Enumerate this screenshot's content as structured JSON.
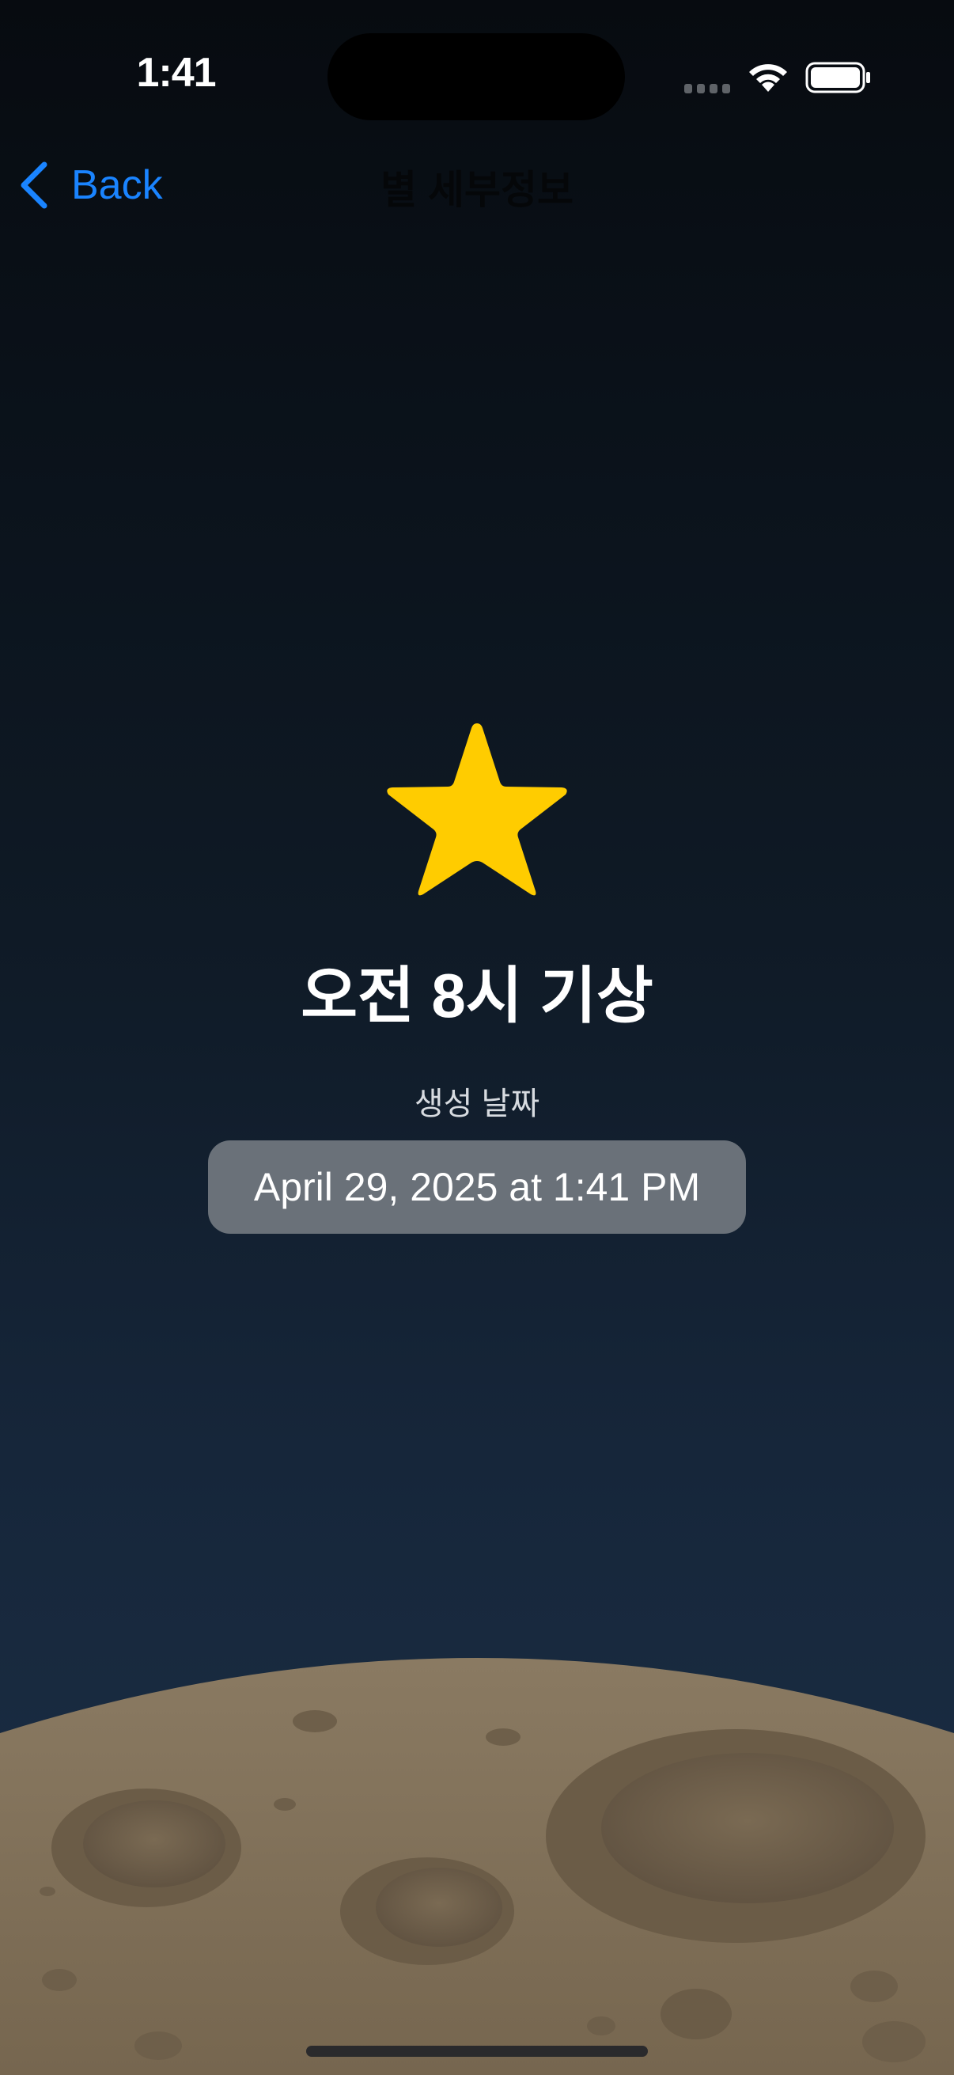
{
  "status_bar": {
    "time": "1:41",
    "icons": [
      "cellular-dots-icon",
      "wifi-icon",
      "battery-icon"
    ]
  },
  "nav": {
    "back_label": "Back",
    "title": "별 세부정보"
  },
  "detail": {
    "icon": "star-icon",
    "title": "오전 8시 기상",
    "created_label": "생성 날짜",
    "created_date": "April 29, 2025 at 1:41 PM"
  },
  "colors": {
    "accent": "#1a84ff",
    "star": "#ffcc00",
    "moon": "#7f6f58",
    "date_pill": "#6a7179"
  }
}
